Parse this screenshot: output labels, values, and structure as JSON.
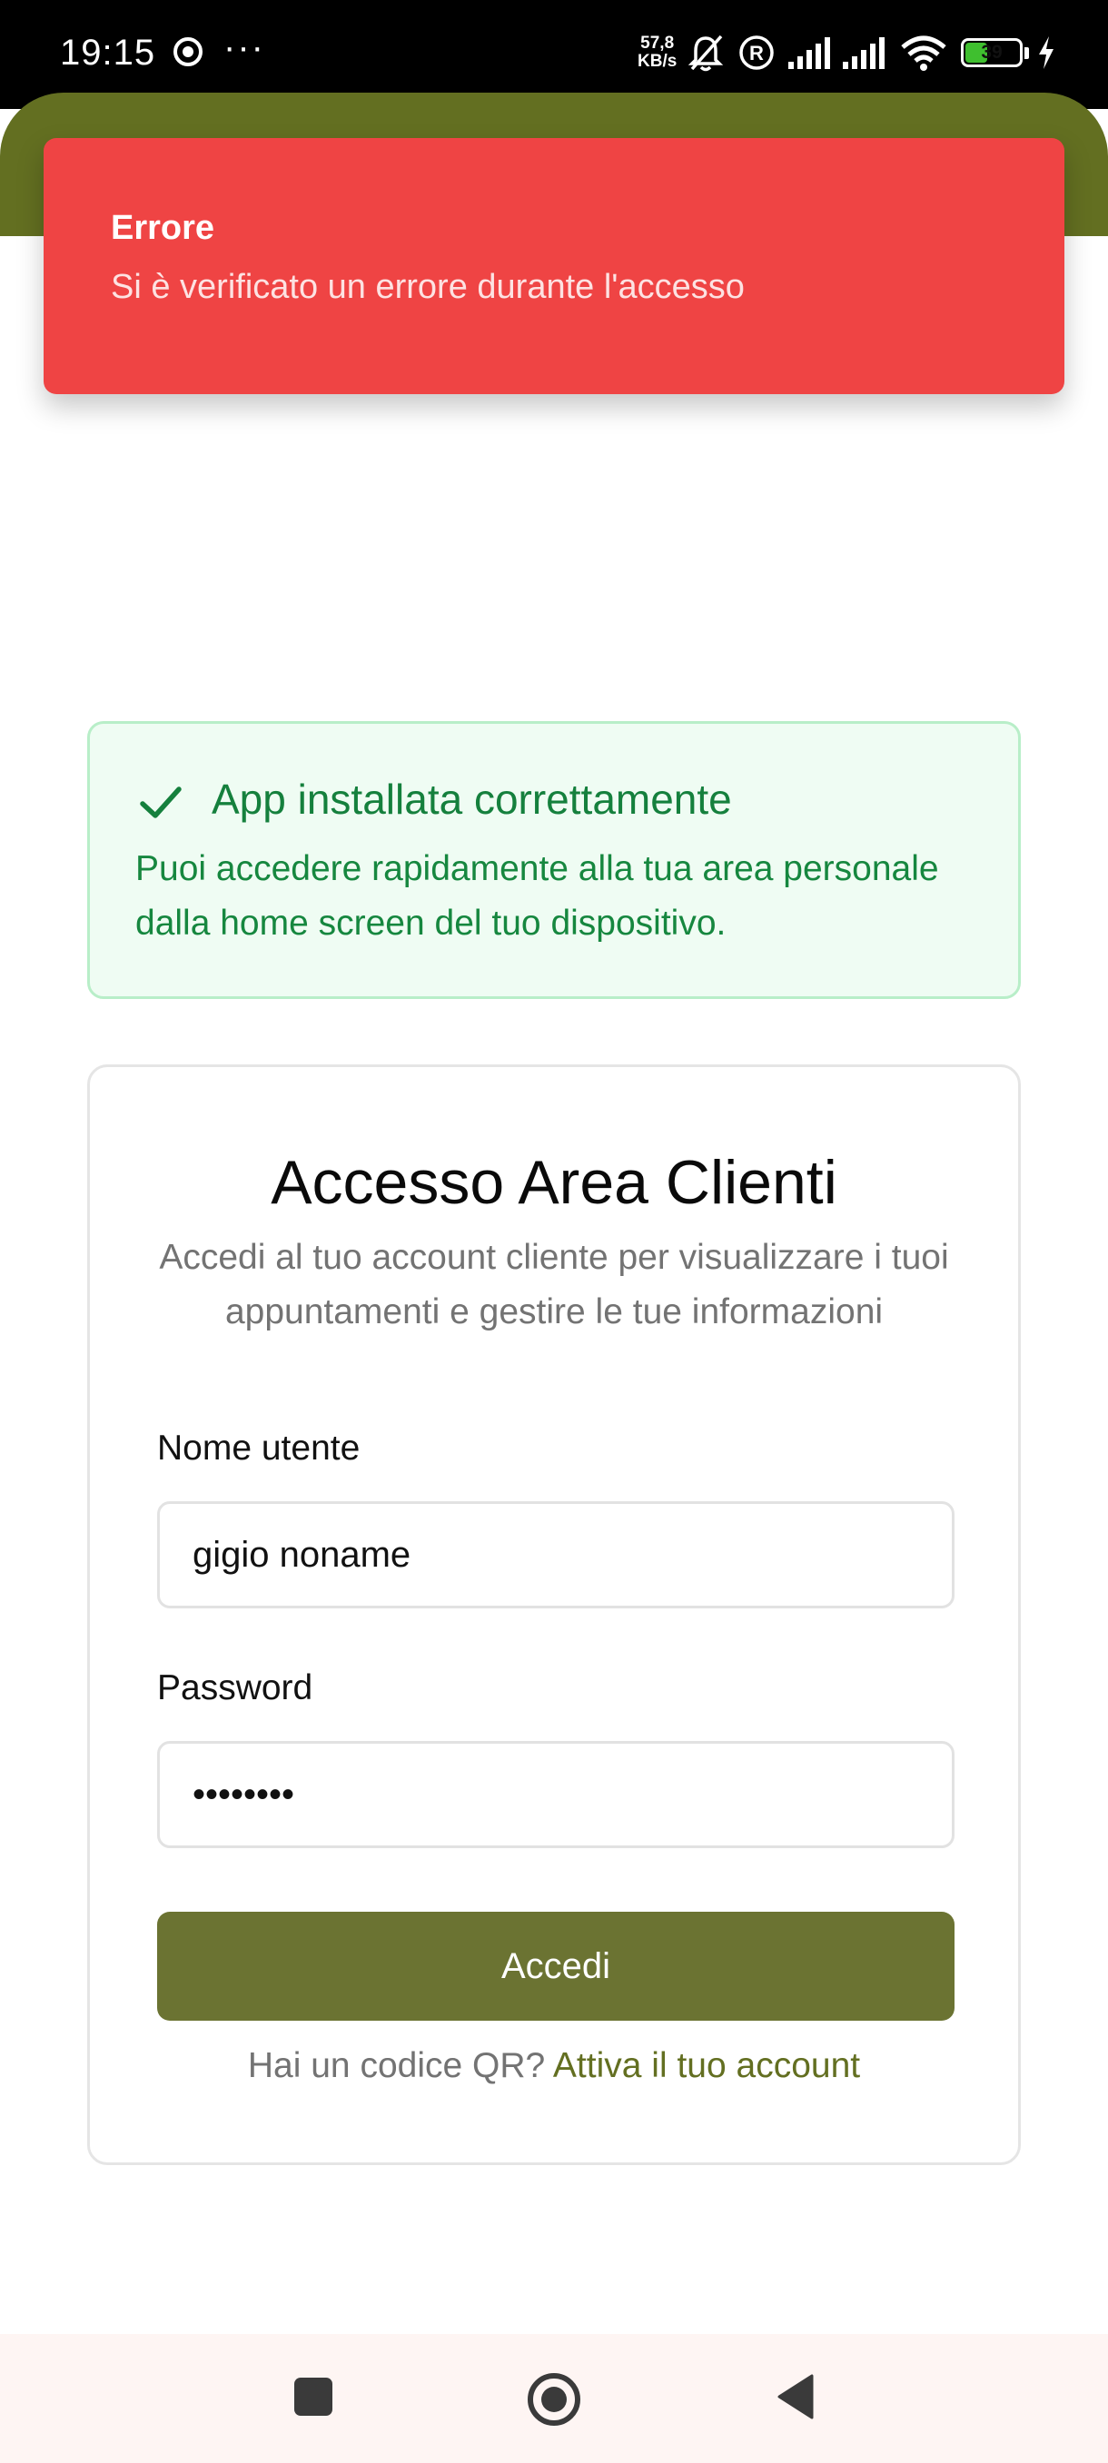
{
  "status_bar": {
    "time": "19:15",
    "more": "···",
    "net_speed_value": "57,8",
    "net_speed_unit": "KB/s",
    "battery": "39",
    "icons": [
      "chrome-icon",
      "mute-bell-icon",
      "registered-icon",
      "signal-icon",
      "signal-icon",
      "wifi-icon",
      "battery-icon",
      "charging-icon"
    ]
  },
  "toast": {
    "title": "Errore",
    "message": "Si è verificato un errore durante l'accesso"
  },
  "install_banner": {
    "title": "App installata correttamente",
    "text": "Puoi accedere rapidamente alla tua area personale dalla home screen del tuo dispositivo.",
    "icon": "check-icon"
  },
  "login": {
    "title": "Accesso Area Clienti",
    "subtitle": "Accedi al tuo account cliente per visualizzare i tuoi appuntamenti e gestire le tue informazioni",
    "username_label": "Nome utente",
    "username_value": "gigio noname",
    "password_label": "Password",
    "password_value": "••••••••",
    "submit_label": "Accedi",
    "qr_prompt": "Hai un codice QR?",
    "activate_link": "Attiva il tuo account"
  },
  "nav_bar": {
    "buttons": [
      "recents-icon",
      "home-icon",
      "back-icon"
    ]
  },
  "colors": {
    "header": "#636f21",
    "primary_button": "#6b7332",
    "error": "#ef4444",
    "success_bg": "#effcf3",
    "success_text": "#15803d"
  }
}
